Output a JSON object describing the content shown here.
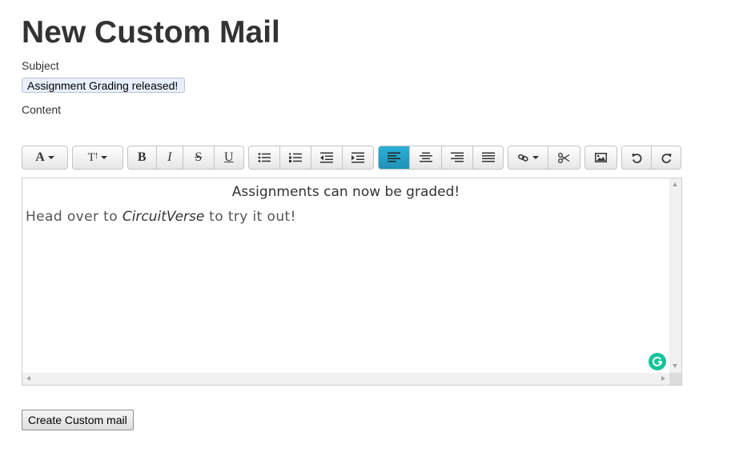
{
  "page": {
    "title": "New Custom Mail"
  },
  "form": {
    "subject_label": "Subject",
    "subject_value": "Assignment Grading released!",
    "content_label": "Content",
    "submit_label": "Create Custom mail"
  },
  "toolbar": {
    "font_style_glyph": "A",
    "font_size_glyph": "T",
    "bold_glyph": "B",
    "italic_glyph": "I",
    "strike_glyph": "S",
    "underline_glyph": "U",
    "active_button": "align-left",
    "active_color": "#1fa3cc",
    "icons": [
      "font-color-icon",
      "font-size-icon",
      "bold-icon",
      "italic-icon",
      "strikethrough-icon",
      "underline-icon",
      "bullet-list-icon",
      "numbered-list-icon",
      "outdent-icon",
      "indent-icon",
      "align-left-icon",
      "align-center-icon",
      "align-right-icon",
      "justify-icon",
      "link-icon",
      "unlink-icon",
      "image-icon",
      "undo-icon",
      "redo-icon"
    ]
  },
  "editor": {
    "heading": "Assignments can now be graded!",
    "body_prefix": "Head over to ",
    "body_brand": "CircuitVerse",
    "body_suffix": " to try it out!"
  },
  "extension": {
    "name": "grammarly-icon",
    "color": "#15c39a"
  }
}
